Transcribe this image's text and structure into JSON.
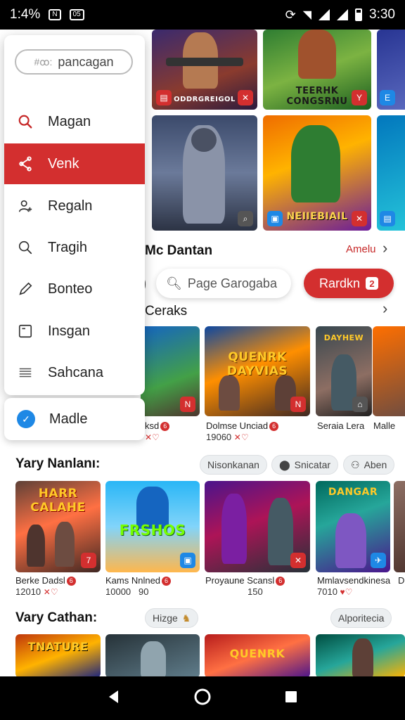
{
  "status": {
    "left_text": "1:4%",
    "box_label": "05",
    "time": "3:30"
  },
  "drawer": {
    "search_prefix": "#ꝏ:",
    "search_text": "pancagan",
    "items": [
      {
        "label": "Magan",
        "icon": "search-icon"
      },
      {
        "label": "Venk",
        "icon": "share-icon",
        "active": true
      },
      {
        "label": "Regaln",
        "icon": "user-add-icon"
      },
      {
        "label": "Tragih",
        "icon": "search-icon"
      },
      {
        "label": "Bonteo",
        "icon": "pencil-icon"
      },
      {
        "label": "Insgan",
        "icon": "save-icon"
      },
      {
        "label": "Sahcana",
        "icon": "menu-icon"
      }
    ],
    "footer_label": "Madle"
  },
  "top_tiles": [
    {
      "caption": "ODDRGREIGOL"
    },
    {
      "caption": "TEERHK CONGSRNU"
    },
    {
      "caption": ""
    },
    {
      "caption": "NEIIEBIAIL"
    }
  ],
  "section1": {
    "title": "Mc Dantan",
    "link": "Amelu",
    "search_placeholder": "Page Garogaba",
    "red_button": "Rardkn",
    "red_button_count": "2",
    "subtitle": "Ceraks"
  },
  "row1": [
    {
      "art": "",
      "name": "ksd",
      "count": ""
    },
    {
      "art": "QUENRK DAYVIAS",
      "name": "Dolmse Unciad",
      "count": "19060"
    },
    {
      "art": "DAYHEW",
      "name": "Seraia Lera",
      "count": ""
    },
    {
      "art": "",
      "name": "Malle",
      "count": ""
    }
  ],
  "section2": {
    "title": "Yary Nanlanı:",
    "chips": [
      "Nisonkanan",
      "Snicatar",
      "Aben"
    ]
  },
  "row2": [
    {
      "art": "HARR CALAHE",
      "name": "Berke Dadsl",
      "count": "12010"
    },
    {
      "art": "FRSHOS",
      "name": "Kams Nnlned",
      "count": "10000",
      "extra": "90"
    },
    {
      "art": "",
      "name": "Proyaune Scansl",
      "count": "150"
    },
    {
      "art": "DANGAR",
      "name": "Mmlavsendkinesa",
      "count": "7010"
    },
    {
      "art": "",
      "name": "D",
      "count": ""
    }
  ],
  "section3": {
    "title": "Vary Cathan:",
    "chip": "Hizge",
    "chip2": "Alporitecia"
  },
  "row3": [
    {
      "art": "TNATURE"
    },
    {
      "art": ""
    },
    {
      "art": "QUENRK"
    },
    {
      "art": ""
    }
  ],
  "colors": {
    "accent": "#d32f2f",
    "blue": "#1e88e5"
  }
}
